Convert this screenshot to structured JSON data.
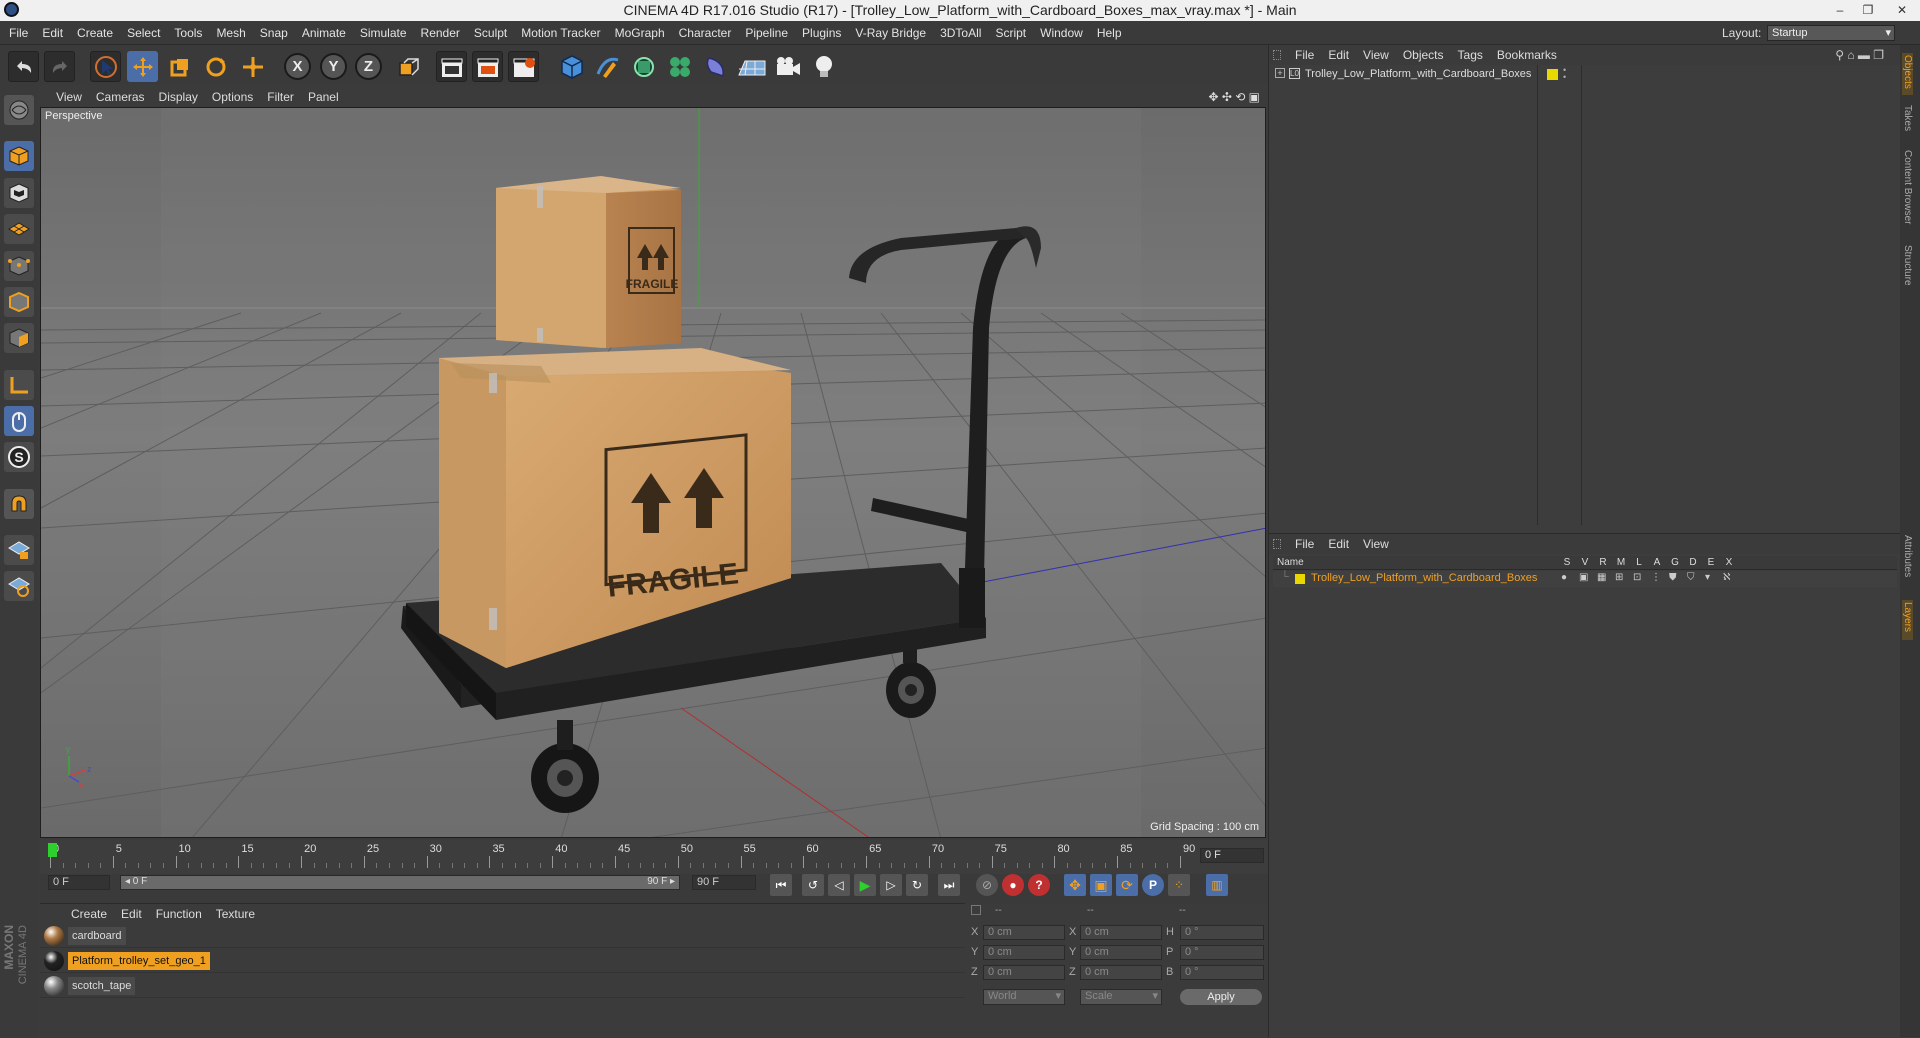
{
  "window": {
    "title": "CINEMA 4D R17.016 Studio (R17) - [Trolley_Low_Platform_with_Cardboard_Boxes_max_vray.max *] - Main",
    "min_symbol": "–",
    "restore_symbol": "❐",
    "close_symbol": "✕"
  },
  "menubar": {
    "items": [
      "File",
      "Edit",
      "Create",
      "Select",
      "Tools",
      "Mesh",
      "Snap",
      "Animate",
      "Simulate",
      "Render",
      "Sculpt",
      "Motion Tracker",
      "MoGraph",
      "Character",
      "Pipeline",
      "Plugins",
      "V-Ray Bridge",
      "3DToAll",
      "Script",
      "Window",
      "Help"
    ],
    "layout_label": "Layout:",
    "layout_value": "Startup"
  },
  "toolbar": {
    "axis_x": "X",
    "axis_y": "Y",
    "axis_z": "Z",
    "icons": [
      "undo-icon",
      "redo-icon",
      "select-icon",
      "move-icon",
      "scale-icon",
      "rotate-icon",
      "live-select-icon",
      "x-axis-icon",
      "y-axis-icon",
      "z-axis-icon",
      "coordinate-system-icon",
      "render-view-icon",
      "render-picture-viewer-icon",
      "edit-render-settings-icon",
      "cube-icon",
      "pen-spline-icon",
      "subdivision-icon",
      "cloner-icon",
      "deformer-icon",
      "floor-icon",
      "camera-icon",
      "light-icon"
    ]
  },
  "viewport": {
    "menu": [
      "View",
      "Cameras",
      "Display",
      "Options",
      "Filter",
      "Panel"
    ],
    "label": "Perspective",
    "grid_spacing": "Grid Spacing : 100 cm",
    "box_label_large": "FRAGILE",
    "box_label_small": "FRAGILE",
    "axis_y": "y",
    "axis_z": "z",
    "axis_x": "x"
  },
  "timeline": {
    "ticks": [
      "0",
      "5",
      "10",
      "15",
      "20",
      "25",
      "30",
      "35",
      "40",
      "45",
      "50",
      "55",
      "60",
      "65",
      "70",
      "75",
      "80",
      "85",
      "90"
    ],
    "current_frame": "0 F",
    "start_field": "0 F",
    "range_start": "◂ 0 F",
    "range_end": "90 F ▸",
    "end_field": "90 F"
  },
  "materials": {
    "menu": [
      "Create",
      "Edit",
      "Function",
      "Texture"
    ],
    "items": [
      {
        "name": "cardboard",
        "selected": false,
        "color": "#b07a45"
      },
      {
        "name": "Platform_trolley_set_geo_1",
        "selected": true,
        "color": "#222222"
      },
      {
        "name": "scotch_tape",
        "selected": false,
        "color": "#888888"
      }
    ],
    "brand1": "MAXON",
    "brand2": "CINEMA 4D"
  },
  "coordinates": {
    "header": [
      "--",
      "--",
      "--"
    ],
    "rows": [
      {
        "a": "X",
        "av": "0 cm",
        "b": "X",
        "bv": "0 cm",
        "c": "H",
        "cv": "0 °"
      },
      {
        "a": "Y",
        "av": "0 cm",
        "b": "Y",
        "bv": "0 cm",
        "c": "P",
        "cv": "0 °"
      },
      {
        "a": "Z",
        "av": "0 cm",
        "b": "Z",
        "bv": "0 cm",
        "c": "B",
        "cv": "0 °"
      }
    ],
    "mode": "World",
    "transform": "Scale",
    "apply": "Apply"
  },
  "objects_panel": {
    "menu": [
      "File",
      "Edit",
      "View",
      "Objects",
      "Tags",
      "Bookmarks"
    ],
    "object_name": "Trolley_Low_Platform_with_Cardboard_Boxes",
    "layer_color": "#e8d800"
  },
  "layers_panel": {
    "menu": [
      "File",
      "Edit",
      "View"
    ],
    "columns": [
      "Name",
      "S",
      "V",
      "R",
      "M",
      "L",
      "A",
      "G",
      "D",
      "E",
      "X"
    ],
    "layer_name": "Trolley_Low_Platform_with_Cardboard_Boxes"
  },
  "side_tabs": [
    "Objects",
    "Takes",
    "Content Browser",
    "Structure",
    "Attributes",
    "Layers"
  ]
}
